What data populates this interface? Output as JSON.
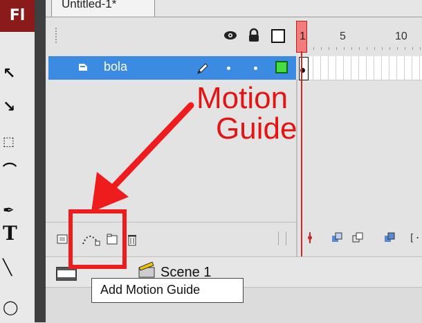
{
  "app": {
    "logo_text": "Fl"
  },
  "document_tab": {
    "title": "Untitled-1*"
  },
  "timeline": {
    "header_icons": [
      "eye-icon",
      "lock-icon",
      "outline-icon"
    ],
    "ruler": {
      "current_frame": "1",
      "marks": [
        "5",
        "10"
      ]
    },
    "layers": [
      {
        "name": "bola",
        "selected": true,
        "visible_dot": "•",
        "lock_dot": "•",
        "outline_color": "#44dd44"
      }
    ]
  },
  "toolbar": {
    "tools": [
      "selection-tool",
      "subselection-tool",
      "free-transform-tool",
      "lasso-tool",
      "pen-tool",
      "text-tool",
      "line-tool",
      "oval-tool"
    ]
  },
  "timeline_buttons": [
    "new-layer-icon",
    "add-motion-guide-icon",
    "new-folder-icon",
    "delete-layer-icon"
  ],
  "annotation": {
    "line1": "Motion",
    "line2": "Guide",
    "color": "#e21414"
  },
  "scene": {
    "label": "Scene 1"
  },
  "tooltip": {
    "text": "Add Motion Guide"
  }
}
